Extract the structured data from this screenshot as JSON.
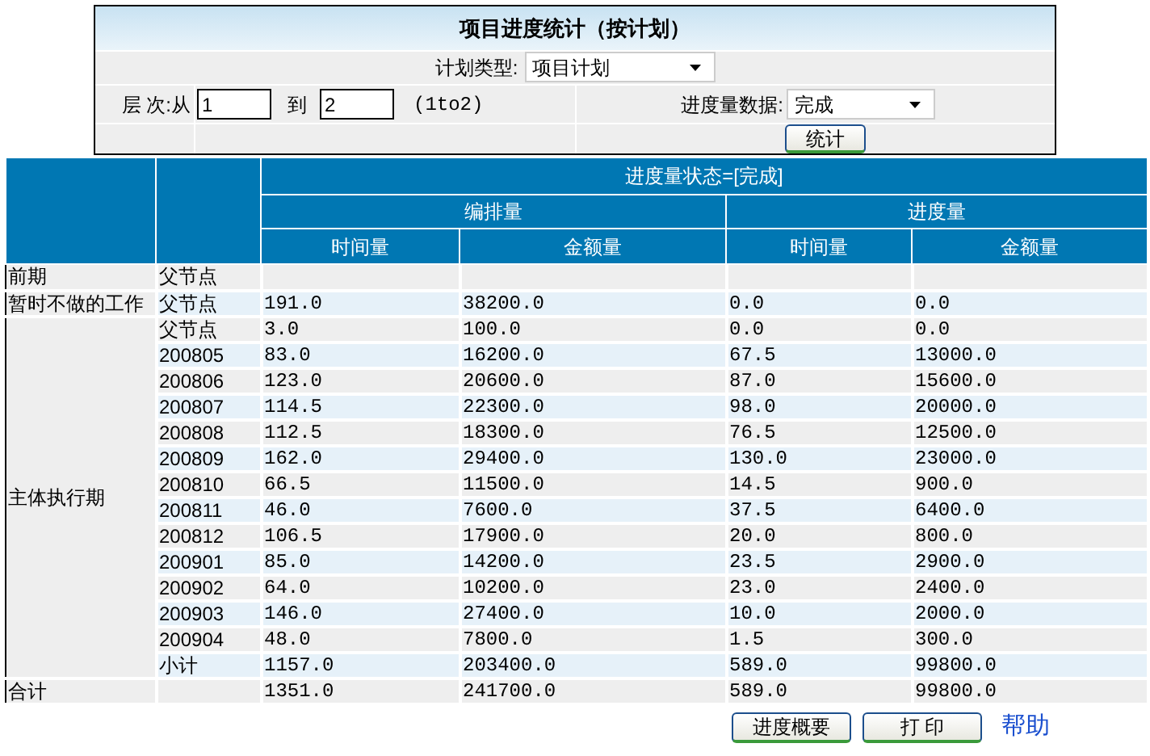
{
  "form": {
    "title": "项目进度统计（按计划）",
    "plan_type": {
      "label": "计划类型:",
      "value": "项目计划"
    },
    "level": {
      "label": "层 次:",
      "from_label": "从",
      "from_value": "1",
      "to_label": "到",
      "to_value": "2",
      "hint": "(1to2)"
    },
    "progress_data": {
      "label": "进度量数据:",
      "value": "完成"
    },
    "submit": "统计"
  },
  "table": {
    "status_header": "进度量状态=[完成]",
    "groups": [
      {
        "label": "编排量",
        "columns": [
          "时间量",
          "金额量"
        ]
      },
      {
        "label": "进度量",
        "columns": [
          "时间量",
          "金额量"
        ]
      }
    ],
    "sections": [
      {
        "label": "前期",
        "rows": [
          {
            "node": "父节点",
            "cells": [
              null,
              null,
              null,
              null
            ]
          }
        ]
      },
      {
        "label": "暂时不做的工作",
        "rows": [
          {
            "node": "父节点",
            "cells": [
              "191.0",
              "38200.0",
              "0.0",
              "0.0"
            ]
          }
        ]
      },
      {
        "label": "主体执行期",
        "rows": [
          {
            "node": "父节点",
            "cells": [
              "3.0",
              "100.0",
              "0.0",
              "0.0"
            ]
          },
          {
            "node": "200805",
            "cells": [
              "83.0",
              "16200.0",
              "67.5",
              "13000.0"
            ]
          },
          {
            "node": "200806",
            "cells": [
              "123.0",
              "20600.0",
              "87.0",
              "15600.0"
            ]
          },
          {
            "node": "200807",
            "cells": [
              "114.5",
              "22300.0",
              "98.0",
              "20000.0"
            ]
          },
          {
            "node": "200808",
            "cells": [
              "112.5",
              "18300.0",
              "76.5",
              "12500.0"
            ]
          },
          {
            "node": "200809",
            "cells": [
              "162.0",
              "29400.0",
              "130.0",
              "23000.0"
            ]
          },
          {
            "node": "200810",
            "cells": [
              "66.5",
              "11500.0",
              "14.5",
              "900.0"
            ]
          },
          {
            "node": "200811",
            "cells": [
              "46.0",
              "7600.0",
              "37.5",
              "6400.0"
            ]
          },
          {
            "node": "200812",
            "cells": [
              "106.5",
              "17900.0",
              "20.0",
              "800.0"
            ]
          },
          {
            "node": "200901",
            "cells": [
              "85.0",
              "14200.0",
              "23.5",
              "2900.0"
            ]
          },
          {
            "node": "200902",
            "cells": [
              "64.0",
              "10200.0",
              "23.0",
              "2400.0"
            ]
          },
          {
            "node": "200903",
            "cells": [
              "146.0",
              "27400.0",
              "10.0",
              "2000.0"
            ]
          },
          {
            "node": "200904",
            "cells": [
              "48.0",
              "7800.0",
              "1.5",
              "300.0"
            ]
          },
          {
            "node": "小计",
            "cells": [
              "1157.0",
              "203400.0",
              "589.0",
              "99800.0"
            ]
          }
        ]
      },
      {
        "label": "合计",
        "rows": [
          {
            "node": null,
            "cells": [
              "1351.0",
              "241700.0",
              "589.0",
              "99800.0"
            ]
          }
        ]
      }
    ]
  },
  "actions": [
    {
      "kind": "button",
      "label": "进度概要"
    },
    {
      "kind": "button",
      "label": "打 印"
    },
    {
      "kind": "link",
      "label": "帮助"
    }
  ]
}
